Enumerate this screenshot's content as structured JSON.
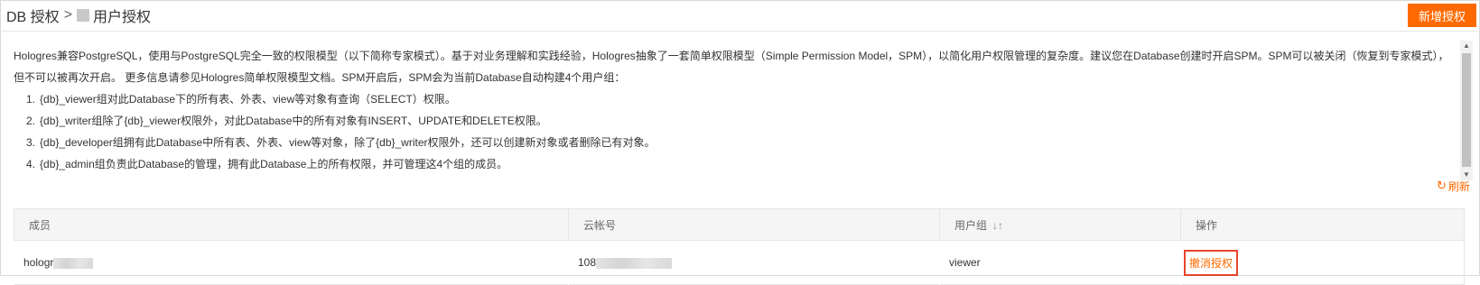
{
  "header": {
    "breadcrumb_root": "DB 授权",
    "breadcrumb_sep": ">",
    "breadcrumb_current": "用户授权",
    "new_button": "新增授权"
  },
  "description": {
    "intro": "Hologres兼容PostgreSQL，使用与PostgreSQL完全一致的权限模型（以下简称专家模式）。基于对业务理解和实践经验，Hologres抽象了一套简单权限模型（Simple Permission Model，SPM），以简化用户权限管理的复杂度。建议您在Database创建时开启SPM。SPM可以被关闭（恢复到专家模式），但不可以被再次开启。 更多信息请参见Hologres简单权限模型文档。SPM开启后，SPM会为当前Database自动构建4个用户组：",
    "items": [
      {
        "num": "1.",
        "text": "{db}_viewer组对此Database下的所有表、外表、view等对象有查询（SELECT）权限。"
      },
      {
        "num": "2.",
        "text": "{db}_writer组除了{db}_viewer权限外，对此Database中的所有对象有INSERT、UPDATE和DELETE权限。"
      },
      {
        "num": "3.",
        "text": "{db}_developer组拥有此Database中所有表、外表、view等对象，除了{db}_writer权限外，还可以创建新对象或者删除已有对象。"
      },
      {
        "num": "4.",
        "text": "{db}_admin组负责此Database的管理，拥有此Database上的所有权限，并可管理这4个组的成员。"
      }
    ]
  },
  "refresh_label": "刷新",
  "icons": {
    "refresh": "refresh-icon",
    "sort": "sort-icon",
    "scroll_up": "scroll-up-icon",
    "scroll_down": "scroll-down-icon"
  },
  "colors": {
    "accent": "#ff6a00",
    "highlight_border": "#e8442b",
    "header_bg": "#f5f5f5"
  },
  "table": {
    "columns": [
      "成员",
      "云帐号",
      "用户组",
      "操作"
    ],
    "rows": [
      {
        "member_visible": "hologr",
        "account_visible": "108",
        "group": "viewer",
        "action": "撤消授权"
      }
    ]
  }
}
